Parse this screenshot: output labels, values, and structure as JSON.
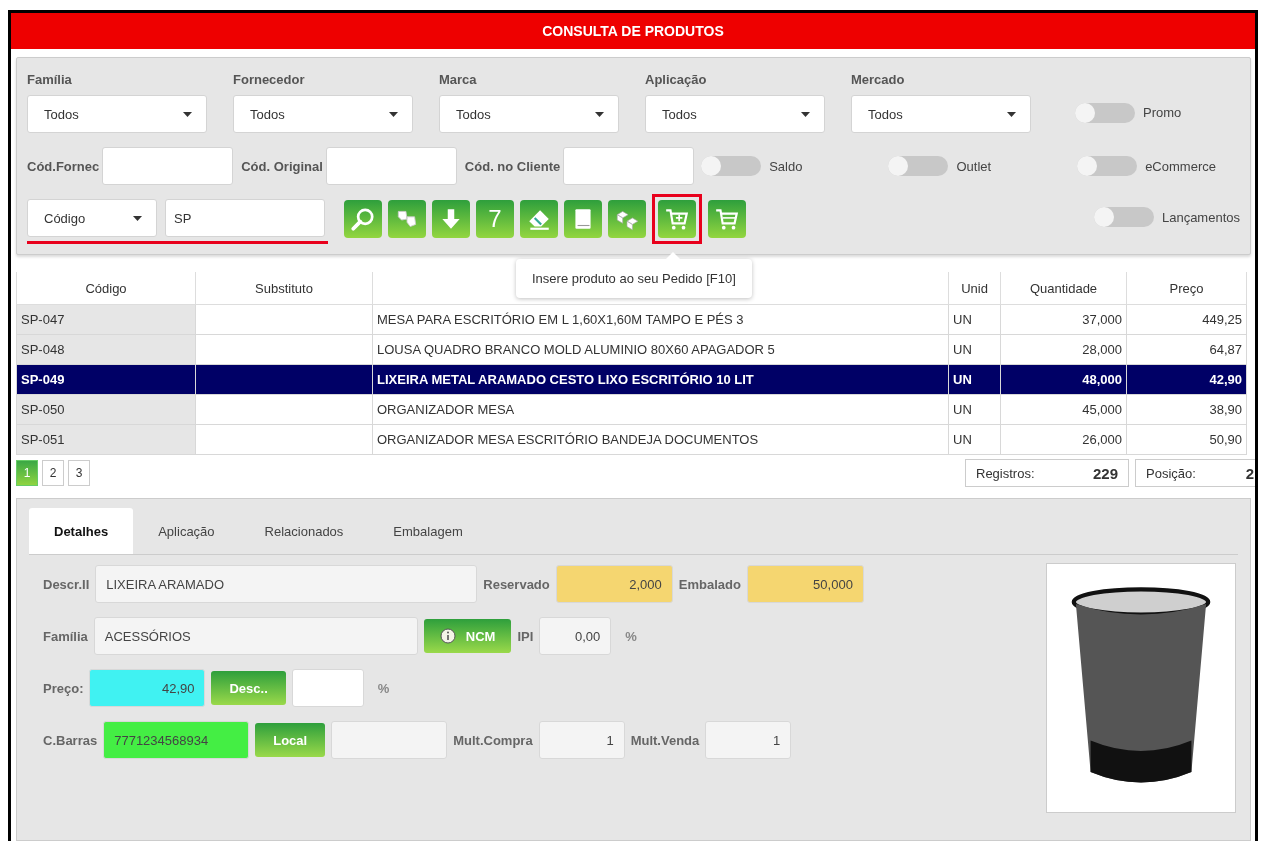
{
  "window": {
    "title": "CONSULTA DE PRODUTOS"
  },
  "filters": {
    "selects": [
      {
        "label": "Família",
        "value": "Todos"
      },
      {
        "label": "Fornecedor",
        "value": "Todos"
      },
      {
        "label": "Marca",
        "value": "Todos"
      },
      {
        "label": "Aplicação",
        "value": "Todos"
      },
      {
        "label": "Mercado",
        "value": "Todos"
      }
    ],
    "code_fields": [
      {
        "label": "Cód.Fornec"
      },
      {
        "label": "Cód. Original"
      },
      {
        "label": "Cód. no Cliente"
      }
    ],
    "toggles": [
      {
        "label": "Promo",
        "on": false
      },
      {
        "label": "Saldo",
        "on": false
      },
      {
        "label": "Outlet",
        "on": false
      },
      {
        "label": "eCommerce",
        "on": false
      },
      {
        "label": "Lançamentos",
        "on": false
      }
    ],
    "search": {
      "field_select": "Código",
      "value": "SP",
      "underlined": true
    },
    "toolbar": [
      {
        "kind": "icon",
        "highlighted": false
      },
      {
        "kind": "icon",
        "highlighted": false
      },
      {
        "kind": "icon",
        "highlighted": false
      },
      {
        "kind": "text",
        "label": "7",
        "highlighted": false
      },
      {
        "kind": "icon",
        "highlighted": false
      },
      {
        "kind": "icon",
        "highlighted": false
      },
      {
        "kind": "icon",
        "highlighted": false
      },
      {
        "kind": "icon",
        "highlighted": true,
        "tooltip": "Insere produto ao seu Pedido [F10]"
      },
      {
        "kind": "icon",
        "highlighted": false
      }
    ]
  },
  "table": {
    "columns": [
      {
        "label": "Código"
      },
      {
        "label": "Substituto"
      },
      {},
      {
        "label": "Unid"
      },
      {
        "label": "Quantidade"
      },
      {
        "label": "Preço"
      }
    ],
    "rows": [
      {
        "selected": false,
        "cells": [
          "SP-047",
          "",
          "MESA PARA ESCRITÓRIO EM L 1,60X1,60M TAMPO E PÉS 3",
          "UN",
          "37,000",
          "449,25"
        ]
      },
      {
        "selected": false,
        "cells": [
          "SP-048",
          "",
          "LOUSA QUADRO BRANCO MOLD ALUMINIO 80X60 APAGADOR 5",
          "UN",
          "28,000",
          "64,87"
        ]
      },
      {
        "selected": true,
        "cells": [
          "SP-049",
          "",
          "LIXEIRA METAL ARAMADO CESTO LIXO ESCRITÓRIO 10 LIT",
          "UN",
          "48,000",
          "42,90"
        ]
      },
      {
        "selected": false,
        "cells": [
          "SP-050",
          "",
          "ORGANIZADOR MESA",
          "UN",
          "45,000",
          "38,90"
        ]
      },
      {
        "selected": false,
        "cells": [
          "SP-051",
          "",
          "ORGANIZADOR MESA ESCRITÓRIO BANDEJA DOCUMENTOS",
          "UN",
          "26,000",
          "50,90"
        ]
      }
    ]
  },
  "pagination": {
    "pages": [
      {
        "label": "1",
        "selected": true
      },
      {
        "label": "2",
        "selected": false
      },
      {
        "label": "3",
        "selected": false
      }
    ],
    "records": {
      "label": "Registros:",
      "value": "229"
    },
    "position": {
      "label": "Posição:",
      "value": "2"
    }
  },
  "details": {
    "tabs": [
      {
        "label": "Detalhes",
        "selected": true
      },
      {
        "label": "Aplicação",
        "selected": false
      },
      {
        "label": "Relacionados",
        "selected": false
      },
      {
        "label": "Embalagem",
        "selected": false
      }
    ],
    "rows": [
      {
        "fields": [
          {
            "kind": "text",
            "label": "Descr.II",
            "value": "LIXEIRA ARAMADO"
          },
          {
            "kind": "number",
            "label": "Reservado",
            "value": "2,000",
            "color": "#f5d670"
          },
          {
            "kind": "number",
            "label": "Embalado",
            "value": "50,000",
            "color": "#f5d670"
          }
        ]
      },
      {
        "fields": [
          {
            "kind": "text",
            "label": "Família",
            "value": "ACESSÓRIOS"
          },
          {
            "kind": "info-button",
            "label": "NCM"
          },
          {
            "kind": "number",
            "label": "IPI",
            "value": "0,00",
            "unit": "%"
          }
        ]
      },
      {
        "fields": [
          {
            "kind": "number",
            "label": "Preço:",
            "value": "42,90",
            "color": "#40f2f2"
          },
          {
            "kind": "button",
            "label": "Desc.."
          },
          {
            "kind": "number",
            "color": "#ffffff",
            "unit": "%"
          }
        ]
      },
      {
        "fields": [
          {
            "kind": "text",
            "label": "C.Barras",
            "value": "7771234568934",
            "color": "#44ee44"
          },
          {
            "kind": "button",
            "label": "Local"
          },
          {
            "kind": "text"
          },
          {
            "kind": "number",
            "label": "Mult.Compra",
            "value": "1"
          },
          {
            "kind": "number",
            "label": "Mult.Venda",
            "value": "1"
          }
        ]
      }
    ]
  }
}
